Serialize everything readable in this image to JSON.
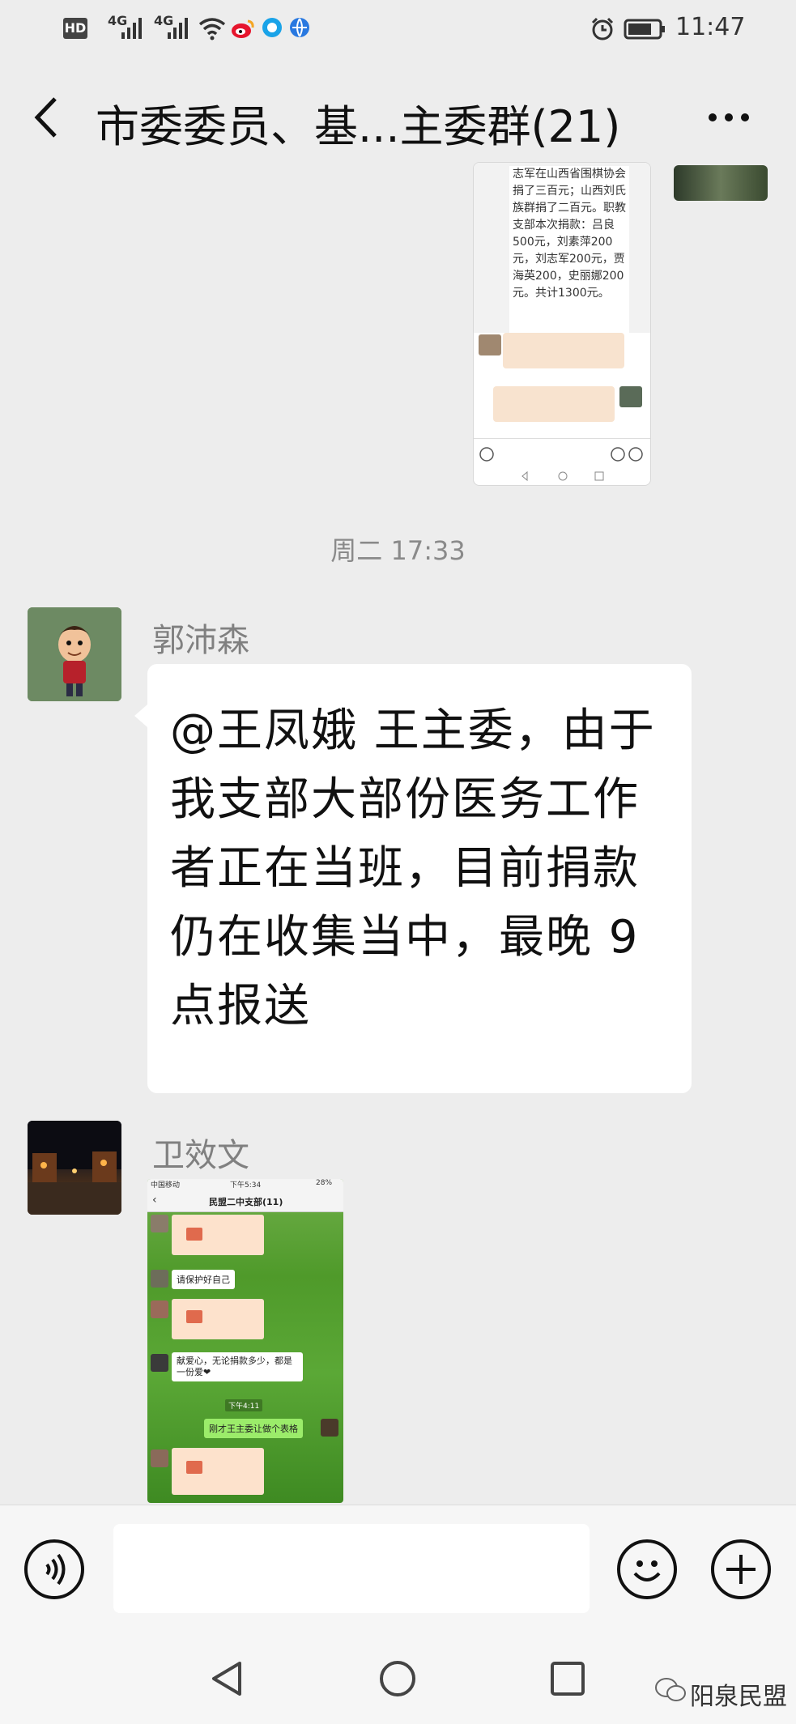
{
  "status_bar": {
    "hd": "HD",
    "net1": "4G",
    "net2": "4G",
    "time": "11:47"
  },
  "nav": {
    "back_icon": "chevron-left-icon",
    "title": "市委委员、基...主委群(21)",
    "more_icon": "more-icon"
  },
  "messages": {
    "screenshot1": {
      "text": "志军在山西省围棋协会捐了三百元；山西刘氏族群捐了二百元。职教支部本次捐款：吕良500元，刘素萍200元，刘志军200元，贾海英200，史丽娜200元。共计1300元。"
    },
    "timestamp": "周二 17:33",
    "msg1": {
      "sender": "郭沛森",
      "text": "@王凤娥  王主委，由于我支部大部份医务工作者正在当班，目前捐款仍在收集当中，最晚 9 点报送"
    },
    "msg2": {
      "sender": "卫效文",
      "screenshot": {
        "carrier": "中国移动",
        "time": "下午5:34",
        "battery": "28%",
        "title": "民盟二中支部(11)",
        "line1": "请保护好自己",
        "line2": "献爱心，无论捐款多少，都是一份爱❤",
        "stamp": "下午4:11",
        "line3": "刚才王主委让做个表格"
      }
    }
  },
  "input_bar": {
    "voice_icon": "voice-icon",
    "emoji_icon": "emoji-icon",
    "plus_icon": "plus-icon"
  },
  "watermark": "阳泉民盟"
}
